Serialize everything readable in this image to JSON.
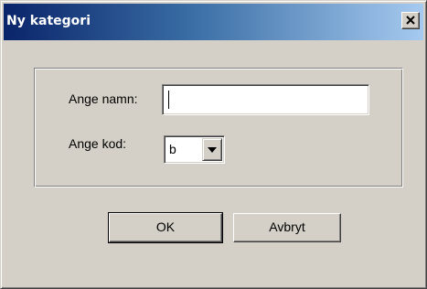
{
  "window": {
    "title": "Ny kategori"
  },
  "form": {
    "name_label": "Ange namn:",
    "name_value": "",
    "code_label": "Ange kod:",
    "code_value": "b"
  },
  "buttons": {
    "ok_label": "OK",
    "cancel_label": "Avbryt"
  },
  "icons": {
    "close": "close-icon",
    "dropdown": "chevron-down-icon"
  },
  "colors": {
    "titlebar_start": "#0a246a",
    "titlebar_end": "#a6caf0",
    "face": "#d4d0c8"
  }
}
